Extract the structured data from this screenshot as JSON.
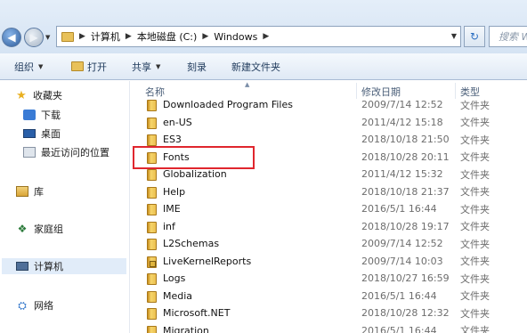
{
  "address_bar": {
    "crumbs": [
      "计算机",
      "本地磁盘 (C:)",
      "Windows"
    ],
    "search_placeholder": "搜索 Wi"
  },
  "toolbar": {
    "organize": "组织",
    "open": "打开",
    "share": "共享",
    "burn": "刻录",
    "new_folder": "新建文件夹"
  },
  "nav": {
    "favorites": "收藏夹",
    "downloads": "下载",
    "desktop": "桌面",
    "recent": "最近访问的位置",
    "libraries": "库",
    "homegroup": "家庭组",
    "computer": "计算机",
    "network": "网络"
  },
  "columns": {
    "name": "名称",
    "date_modified": "修改日期",
    "type": "类型"
  },
  "files": [
    {
      "name": "Downloaded Program Files",
      "date": "2009/7/14 12:52",
      "type": "文件夹"
    },
    {
      "name": "en-US",
      "date": "2011/4/12 15:18",
      "type": "文件夹"
    },
    {
      "name": "ES3",
      "date": "2018/10/18 21:50",
      "type": "文件夹"
    },
    {
      "name": "Fonts",
      "date": "2018/10/28 20:11",
      "type": "文件夹"
    },
    {
      "name": "Globalization",
      "date": "2011/4/12 15:32",
      "type": "文件夹"
    },
    {
      "name": "Help",
      "date": "2018/10/18 21:37",
      "type": "文件夹"
    },
    {
      "name": "IME",
      "date": "2016/5/1 16:44",
      "type": "文件夹"
    },
    {
      "name": "inf",
      "date": "2018/10/28 19:17",
      "type": "文件夹"
    },
    {
      "name": "L2Schemas",
      "date": "2009/7/14 12:52",
      "type": "文件夹"
    },
    {
      "name": "LiveKernelReports",
      "date": "2009/7/14 10:03",
      "type": "文件夹"
    },
    {
      "name": "Logs",
      "date": "2018/10/27 16:59",
      "type": "文件夹"
    },
    {
      "name": "Media",
      "date": "2016/5/1 16:44",
      "type": "文件夹"
    },
    {
      "name": "Microsoft.NET",
      "date": "2018/10/28 12:32",
      "type": "文件夹"
    },
    {
      "name": "Migration",
      "date": "2016/5/1 16:44",
      "type": "文件夹"
    }
  ],
  "highlighted_file": "Fonts",
  "colors": {
    "highlight_border": "#e0262e",
    "toolbar_text": "#1e395b"
  }
}
